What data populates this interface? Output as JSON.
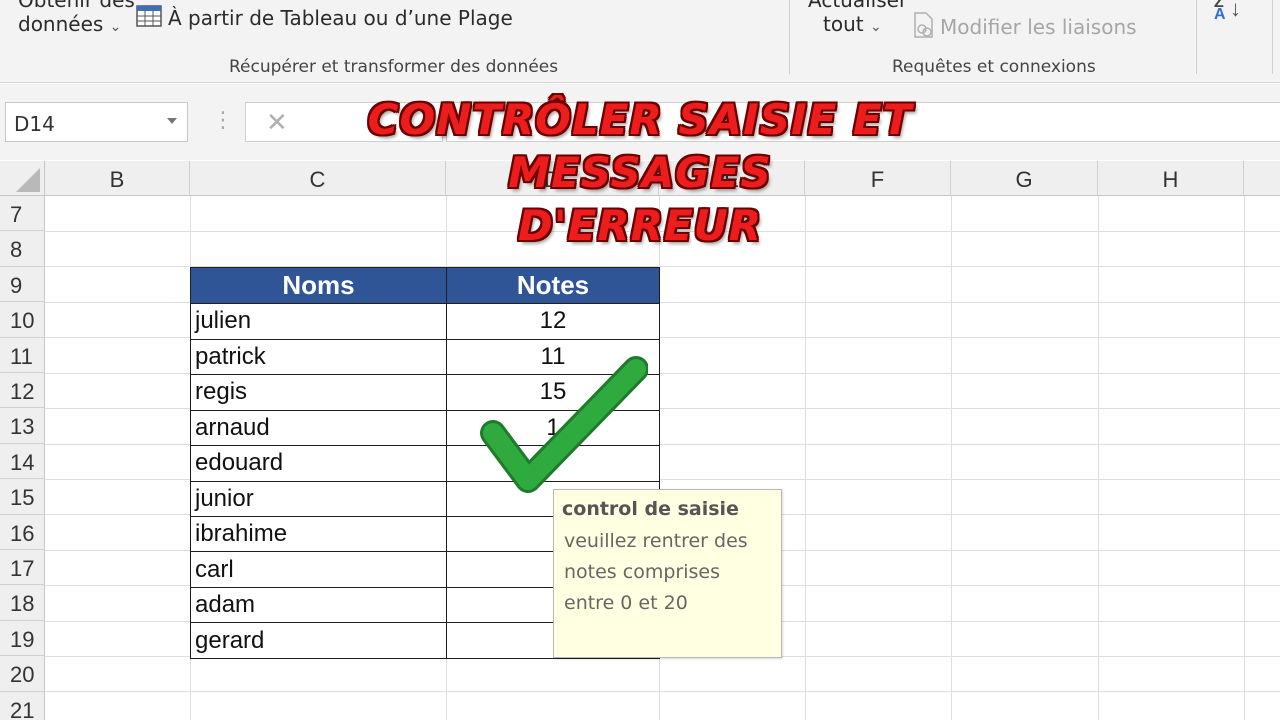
{
  "ribbon": {
    "get_data_line1": "Obtenir des",
    "get_data_line2": "données",
    "from_table": "À partir de Tableau ou d’une Plage",
    "refresh_line1": "Actualiser",
    "refresh_line2": "tout",
    "edit_links": "Modifier les liaisons",
    "group_get_transform": "Récupérer et transformer des données",
    "group_queries": "Requêtes et connexions",
    "sort_glyph": "Z A"
  },
  "formula_bar": {
    "name_box": "D14",
    "cancel_glyph": "✕",
    "formula_value": ""
  },
  "sheet": {
    "columns": [
      "B",
      "C",
      "D",
      "E",
      "F",
      "G",
      "H"
    ],
    "rows": [
      "7",
      "8",
      "9",
      "10",
      "11",
      "12",
      "13",
      "14",
      "15",
      "16",
      "17",
      "18",
      "19",
      "20",
      "21"
    ]
  },
  "table": {
    "header_name": "Noms",
    "header_notes": "Notes",
    "header_color": "#2f5597",
    "rows": [
      {
        "name": "julien",
        "note": "12"
      },
      {
        "name": "patrick",
        "note": "11"
      },
      {
        "name": "regis",
        "note": "15"
      },
      {
        "name": "arnaud",
        "note": "1"
      },
      {
        "name": "edouard",
        "note": ""
      },
      {
        "name": "junior",
        "note": ""
      },
      {
        "name": "ibrahime",
        "note": ""
      },
      {
        "name": "carl",
        "note": ""
      },
      {
        "name": "adam",
        "note": ""
      },
      {
        "name": "gerard",
        "note": ""
      }
    ]
  },
  "tooltip": {
    "title": "control de saisie",
    "line1": "veuillez rentrer des",
    "line2": "notes comprises",
    "line3": "entre 0 et 20"
  },
  "overlay": {
    "title_line1": "CONTRÔLER SAISIE ET MESSAGES",
    "title_line2": "D'ERREUR",
    "title_color": "#ee1d1d",
    "checkmark_icon": "check-icon",
    "checkmark_color": "#2eaa3e"
  }
}
